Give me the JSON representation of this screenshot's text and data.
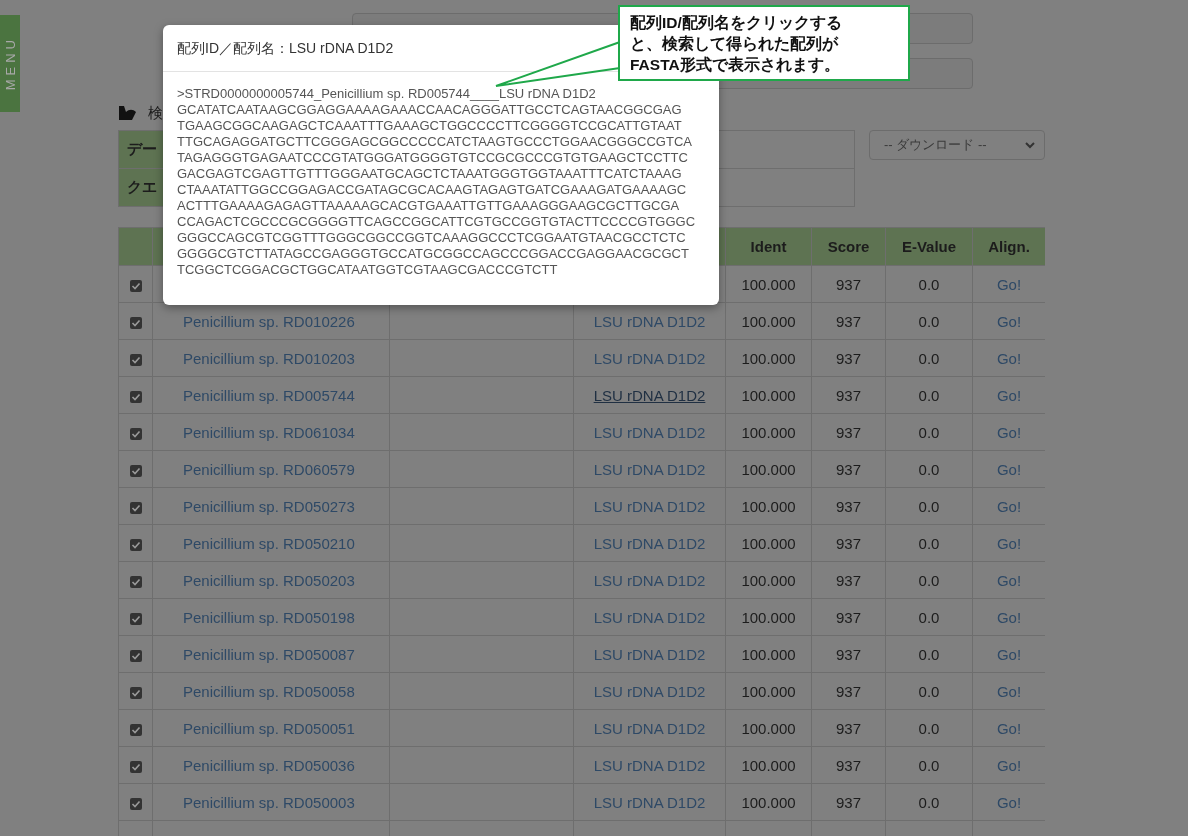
{
  "side_menu": {
    "label": "MENU"
  },
  "search_form": {
    "fields": [
      {
        "kind": "text"
      },
      {
        "kind": "text"
      }
    ]
  },
  "results_heading": {
    "text": "検"
  },
  "info_table": {
    "rows": [
      {
        "label": "デー"
      },
      {
        "label": "クエ"
      }
    ]
  },
  "download_select": {
    "value": "-- ダウンロード --"
  },
  "results_table": {
    "columns": [
      {
        "label": "Ident"
      },
      {
        "label": "Score"
      },
      {
        "label": "E-Value"
      },
      {
        "label": "Align."
      }
    ],
    "rows": [
      {
        "checked": true,
        "ident": "100.000",
        "score": "937",
        "evalue": "0.0",
        "align": "Go!"
      },
      {
        "checked": true,
        "name": "Penicillium sp. RD010226",
        "sequence": "LSU rDNA D1D2",
        "hovered": false,
        "ident": "100.000",
        "score": "937",
        "evalue": "0.0",
        "align": "Go!"
      },
      {
        "checked": true,
        "name": "Penicillium sp. RD010203",
        "sequence": "LSU rDNA D1D2",
        "hovered": false,
        "ident": "100.000",
        "score": "937",
        "evalue": "0.0",
        "align": "Go!"
      },
      {
        "checked": true,
        "name": "Penicillium sp. RD005744",
        "sequence": "LSU rDNA D1D2",
        "hovered": true,
        "ident": "100.000",
        "score": "937",
        "evalue": "0.0",
        "align": "Go!"
      },
      {
        "checked": true,
        "name": "Penicillium sp. RD061034",
        "sequence": "LSU rDNA D1D2",
        "hovered": false,
        "ident": "100.000",
        "score": "937",
        "evalue": "0.0",
        "align": "Go!"
      },
      {
        "checked": true,
        "name": "Penicillium sp. RD060579",
        "sequence": "LSU rDNA D1D2",
        "hovered": false,
        "ident": "100.000",
        "score": "937",
        "evalue": "0.0",
        "align": "Go!"
      },
      {
        "checked": true,
        "name": "Penicillium sp. RD050273",
        "sequence": "LSU rDNA D1D2",
        "hovered": false,
        "ident": "100.000",
        "score": "937",
        "evalue": "0.0",
        "align": "Go!"
      },
      {
        "checked": true,
        "name": "Penicillium sp. RD050210",
        "sequence": "LSU rDNA D1D2",
        "hovered": false,
        "ident": "100.000",
        "score": "937",
        "evalue": "0.0",
        "align": "Go!"
      },
      {
        "checked": true,
        "name": "Penicillium sp. RD050203",
        "sequence": "LSU rDNA D1D2",
        "hovered": false,
        "ident": "100.000",
        "score": "937",
        "evalue": "0.0",
        "align": "Go!"
      },
      {
        "checked": true,
        "name": "Penicillium sp. RD050198",
        "sequence": "LSU rDNA D1D2",
        "hovered": false,
        "ident": "100.000",
        "score": "937",
        "evalue": "0.0",
        "align": "Go!"
      },
      {
        "checked": true,
        "name": "Penicillium sp. RD050087",
        "sequence": "LSU rDNA D1D2",
        "hovered": false,
        "ident": "100.000",
        "score": "937",
        "evalue": "0.0",
        "align": "Go!"
      },
      {
        "checked": true,
        "name": "Penicillium sp. RD050058",
        "sequence": "LSU rDNA D1D2",
        "hovered": false,
        "ident": "100.000",
        "score": "937",
        "evalue": "0.0",
        "align": "Go!"
      },
      {
        "checked": true,
        "name": "Penicillium sp. RD050051",
        "sequence": "LSU rDNA D1D2",
        "hovered": false,
        "ident": "100.000",
        "score": "937",
        "evalue": "0.0",
        "align": "Go!"
      },
      {
        "checked": true,
        "name": "Penicillium sp. RD050036",
        "sequence": "LSU rDNA D1D2",
        "hovered": false,
        "ident": "100.000",
        "score": "937",
        "evalue": "0.0",
        "align": "Go!"
      },
      {
        "checked": true,
        "name": "Penicillium sp. RD050003",
        "sequence": "LSU rDNA D1D2",
        "hovered": false,
        "ident": "100.000",
        "score": "937",
        "evalue": "0.0",
        "align": "Go!"
      }
    ]
  },
  "modal": {
    "title": "配列ID／配列名：LSU rDNA D1D2",
    "fasta": [
      ">STRD0000000005744_Penicillium sp. RD005744____LSU rDNA D1D2",
      "GCATATCAATAAGCGGAGGAAAAGAAACCAACAGGGATTGCCTCAGTAACGGCGAG",
      "TGAAGCGGCAAGAGCTCAAATTTGAAAGCTGGCCCCTTCGGGGTCCGCATTGTAAT",
      "TTGCAGAGGATGCTTCGGGAGCGGCCCCCATCTAAGTGCCCTGGAACGGGCCGTCA",
      "TAGAGGGTGAGAATCCCGTATGGGATGGGGTGTCCGCGCCCGTGTGAAGCTCCTTC",
      "GACGAGTCGAGTTGTTTGGGAATGCAGCTCTAAATGGGTGGTAAATTTCATCTAAAG",
      "CTAAATATTGGCCGGAGACCGATAGCGCACAAGTAGAGTGATCGAAAGATGAAAAGC",
      "ACTTTGAAAAGAGAGTTAAAAAGCACGTGAAATTGTTGAAAGGGAAGCGCTTGCGA",
      "CCAGACTCGCCCGCGGGGTTCAGCCGGCATTCGTGCCGGTGTACTTCCCCGTGGGC",
      "GGGCCAGCGTCGGTTTGGGCGGCCGGTCAAAGGCCCTCGGAATGTAACGCCTCTC",
      "GGGGCGTCTTATAGCCGAGGGTGCCATGCGGCCAGCCCGGACCGAGGAACGCGCT",
      "TCGGCTCGGACGCTGGCATAATGGTCGTAAGCGACCCGTCTT"
    ]
  },
  "callout": {
    "lines": [
      "配列ID/配列名をクリックする",
      "と、検索して得られた配列が",
      "FASTA形式で表示されます。"
    ]
  }
}
